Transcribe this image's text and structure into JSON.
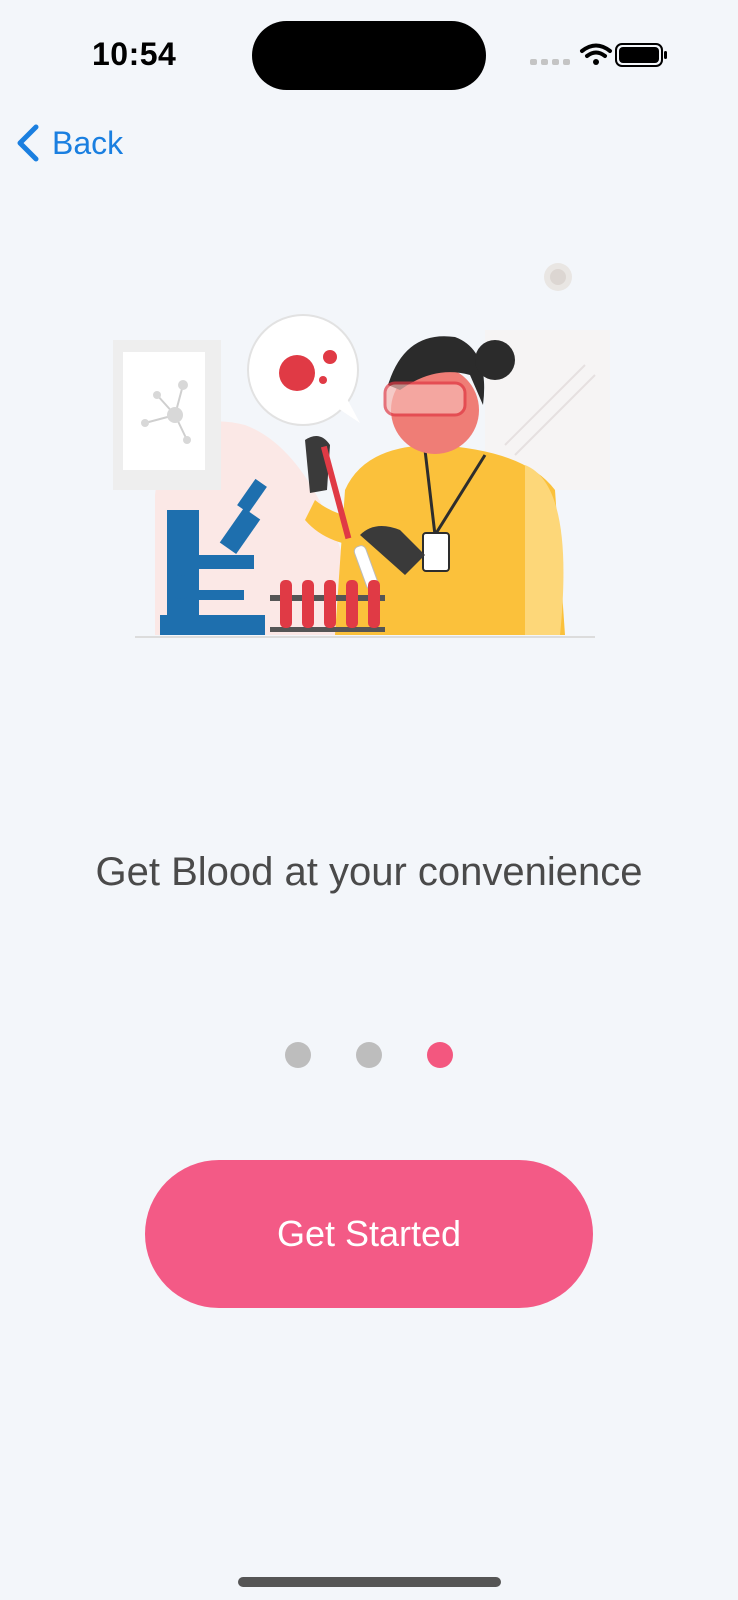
{
  "status_bar": {
    "time": "10:54",
    "icons": [
      "cellular-signal-icon",
      "wifi-icon",
      "battery-icon"
    ]
  },
  "nav": {
    "back_label": "Back",
    "back_icon": "chevron-left-icon"
  },
  "illustration": {
    "subject": "lab-scientist-blood-test-illustration"
  },
  "onboarding": {
    "headline": "Get Blood at your convenience",
    "page_count": 3,
    "current_page": 3
  },
  "cta": {
    "label": "Get Started"
  },
  "colors": {
    "background": "#f3f6fa",
    "accent": "#f35a86",
    "link": "#1a7fe0",
    "dot_inactive": "#bdbdbd",
    "headline": "#4a4a4a"
  }
}
